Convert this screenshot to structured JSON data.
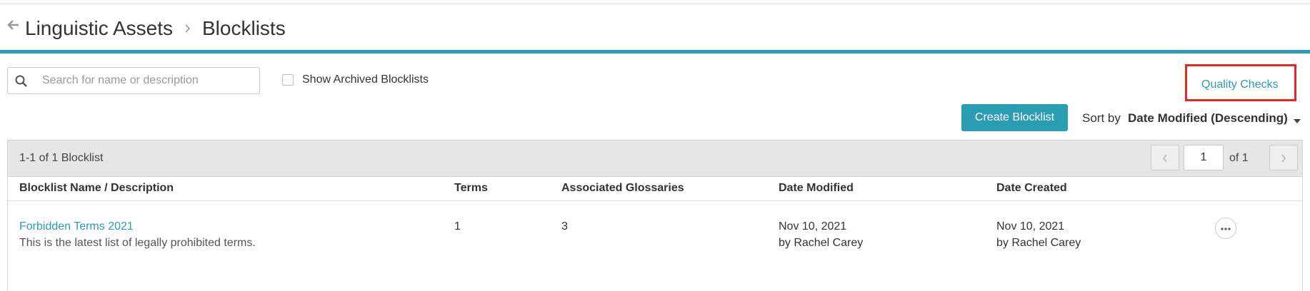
{
  "header": {
    "back_icon": "back-arrow-icon",
    "breadcrumb": [
      "Linguistic Assets",
      "Blocklists"
    ],
    "separator_icon": "chevron-right-icon"
  },
  "toolbar": {
    "search_placeholder": "Search for name or description",
    "search_value": "",
    "show_archived_label": "Show Archived Blocklists",
    "show_archived_checked": false,
    "quality_checks_label": "Quality Checks",
    "create_button_label": "Create Blocklist",
    "sort_label": "Sort by",
    "sort_value": "Date Modified (Descending)"
  },
  "table": {
    "count_label": "1-1 of 1 Blocklist",
    "pagination": {
      "current_page": "1",
      "of_label": "of 1"
    },
    "columns": [
      "Blocklist Name / Description",
      "Terms",
      "Associated Glossaries",
      "Date Modified",
      "Date Created"
    ],
    "rows": [
      {
        "name": "Forbidden Terms 2021",
        "description": "This is the latest list of legally prohibited terms.",
        "terms": "1",
        "glossaries": "3",
        "date_modified": "Nov 10, 2021",
        "modified_by": "by Rachel Carey",
        "date_created": "Nov 10, 2021",
        "created_by": "by Rachel Carey"
      }
    ]
  },
  "colors": {
    "accent": "#2a9db3",
    "highlight_box": "#e12b2b",
    "header_bar": "#e6e6e6"
  }
}
